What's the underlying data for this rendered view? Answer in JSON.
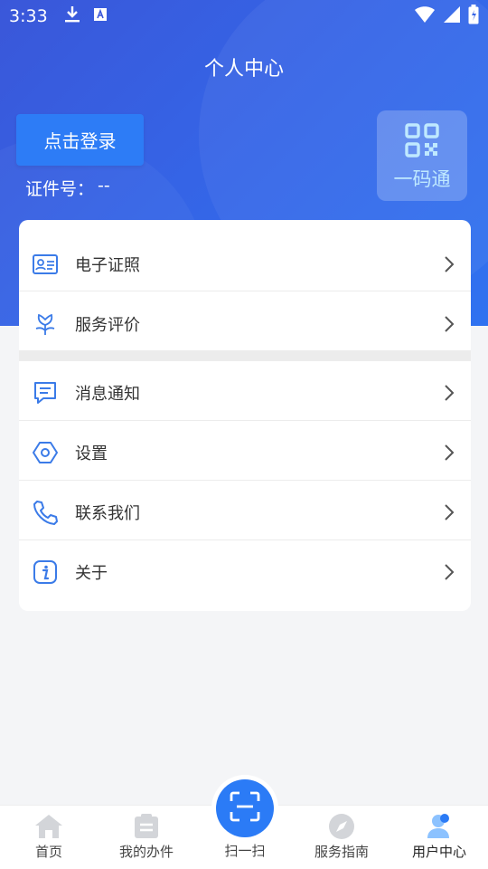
{
  "status_bar": {
    "time": "3:33",
    "icons": [
      "download-icon",
      "a-icon",
      "wifi-icon",
      "signal-icon",
      "battery-icon"
    ]
  },
  "header": {
    "title": "个人中心",
    "login_label": "点击登录",
    "id_label": "证件号：",
    "id_value": "--",
    "qr_label": "一码通"
  },
  "menu": {
    "group1": [
      {
        "label": "电子证照",
        "icon": "id-card-icon"
      },
      {
        "label": "服务评价",
        "icon": "flower-icon"
      }
    ],
    "group2": [
      {
        "label": "消息通知",
        "icon": "message-icon"
      },
      {
        "label": "设置",
        "icon": "settings-icon"
      },
      {
        "label": "联系我们",
        "icon": "phone-icon"
      },
      {
        "label": "关于",
        "icon": "info-icon"
      }
    ]
  },
  "tabbar": {
    "items": [
      {
        "label": "首页",
        "icon": "home-icon"
      },
      {
        "label": "我的办件",
        "icon": "files-icon"
      },
      {
        "label": "扫一扫",
        "icon": "scan-icon"
      },
      {
        "label": "服务指南",
        "icon": "compass-icon"
      },
      {
        "label": "用户中心",
        "icon": "user-icon"
      }
    ],
    "active_index": 4
  },
  "colors": {
    "primary": "#2d7cf6",
    "header_start": "#3a57d9",
    "header_end": "#2f72f0",
    "icon_blue": "#3b7be8",
    "inactive_tab": "#d3d5d9"
  }
}
